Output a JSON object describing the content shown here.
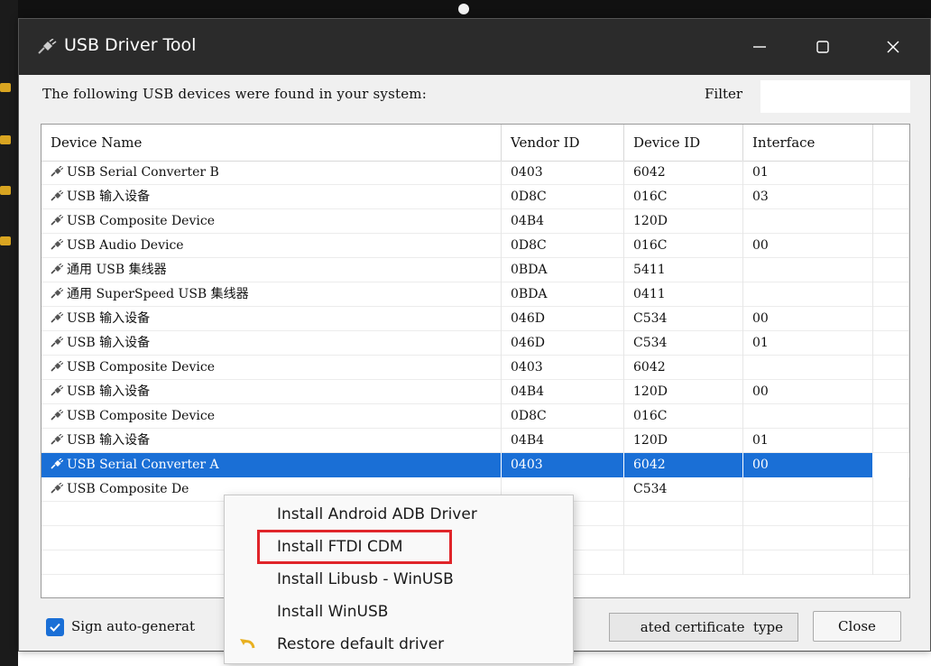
{
  "window": {
    "title": "USB Driver Tool",
    "minimize_glyph": "—",
    "maximize_glyph": "☐",
    "close_glyph": "✕"
  },
  "header": {
    "found_text": "The following USB devices were found in your system:",
    "filter_label": "Filter",
    "filter_value": ""
  },
  "table": {
    "columns": [
      "Device Name",
      "Vendor ID",
      "Device ID",
      "Interface"
    ],
    "rows": [
      {
        "name": "USB Serial Converter B",
        "vendor": "0403",
        "device": "6042",
        "iface": "01"
      },
      {
        "name": "USB 输入设备",
        "vendor": "0D8C",
        "device": "016C",
        "iface": "03"
      },
      {
        "name": "USB Composite Device",
        "vendor": "04B4",
        "device": "120D",
        "iface": ""
      },
      {
        "name": "USB Audio Device",
        "vendor": "0D8C",
        "device": "016C",
        "iface": "00"
      },
      {
        "name": "通用 USB 集线器",
        "vendor": "0BDA",
        "device": "5411",
        "iface": ""
      },
      {
        "name": "通用 SuperSpeed USB 集线器",
        "vendor": "0BDA",
        "device": "0411",
        "iface": ""
      },
      {
        "name": "USB 输入设备",
        "vendor": "046D",
        "device": "C534",
        "iface": "00"
      },
      {
        "name": "USB 输入设备",
        "vendor": "046D",
        "device": "C534",
        "iface": "01"
      },
      {
        "name": "USB Composite Device",
        "vendor": "0403",
        "device": "6042",
        "iface": ""
      },
      {
        "name": "USB 输入设备",
        "vendor": "04B4",
        "device": "120D",
        "iface": "00"
      },
      {
        "name": "USB Composite Device",
        "vendor": "0D8C",
        "device": "016C",
        "iface": ""
      },
      {
        "name": "USB 输入设备",
        "vendor": "04B4",
        "device": "120D",
        "iface": "01"
      },
      {
        "name": "USB Serial Converter A",
        "vendor": "0403",
        "device": "6042",
        "iface": "00",
        "selected": true
      },
      {
        "name": "USB Composite De",
        "vendor": "",
        "device": "C534",
        "iface": ""
      }
    ]
  },
  "footer": {
    "sign_label": "Sign auto-generat",
    "cert_type_label": "ated certificate  type",
    "close_label": "Close"
  },
  "context_menu": {
    "items": [
      "Install Android ADB Driver",
      "Install FTDI CDM",
      "Install Libusb - WinUSB",
      "Install WinUSB",
      "Restore default driver"
    ],
    "highlighted_index": 1
  },
  "colors": {
    "selection": "#1a6fd6",
    "titlebar": "#2b2b2b",
    "highlight_box": "#e0252a"
  },
  "icons": {
    "app": "usb-plug-icon",
    "device": "usb-plug-icon",
    "restore": "undo-arrow-icon"
  }
}
